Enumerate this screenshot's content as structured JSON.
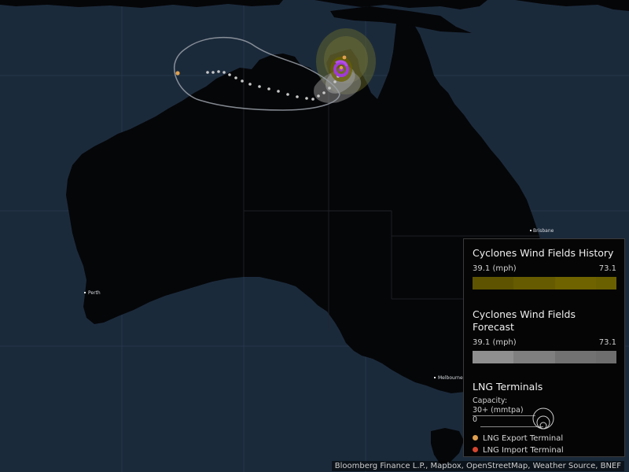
{
  "map": {
    "cities": [
      {
        "name": "Brisbane"
      },
      {
        "name": "Perth"
      },
      {
        "name": "Melbourne"
      }
    ]
  },
  "legend": {
    "history": {
      "title": "Cyclones Wind Fields History",
      "min_label": "39.1 (mph)",
      "max_label": "73.1",
      "colors": [
        "#5e5300",
        "#5e5300",
        "#665b00",
        "#665b00",
        "#6f6300",
        "#6f6300",
        "#6a6000"
      ]
    },
    "forecast": {
      "title": "Cyclones Wind Fields Forecast",
      "min_label": "39.1 (mph)",
      "max_label": "73.1",
      "colors": [
        "#8f8f8f",
        "#8f8f8f",
        "#7f7f7f",
        "#7f7f7f",
        "#727272",
        "#727272",
        "#6e6e6e"
      ]
    },
    "lng": {
      "title": "LNG Terminals",
      "capacity_label": "Capacity:",
      "capacity_max": "30+ (mmtpa)",
      "capacity_min": "0",
      "export_label": "LNG Export Terminal",
      "import_label": "LNG Import Terminal",
      "export_color": "#e0a050",
      "import_color": "#d7462e"
    }
  },
  "attribution": "Bloomberg Finance L.P., Mapbox, OpenStreetMap, Weather Source, BNEF",
  "colors": {
    "ocean": "#1b2a3b",
    "land": "#050608",
    "track": "#b7b7b7",
    "cyclone_center": "#a03ad8"
  }
}
